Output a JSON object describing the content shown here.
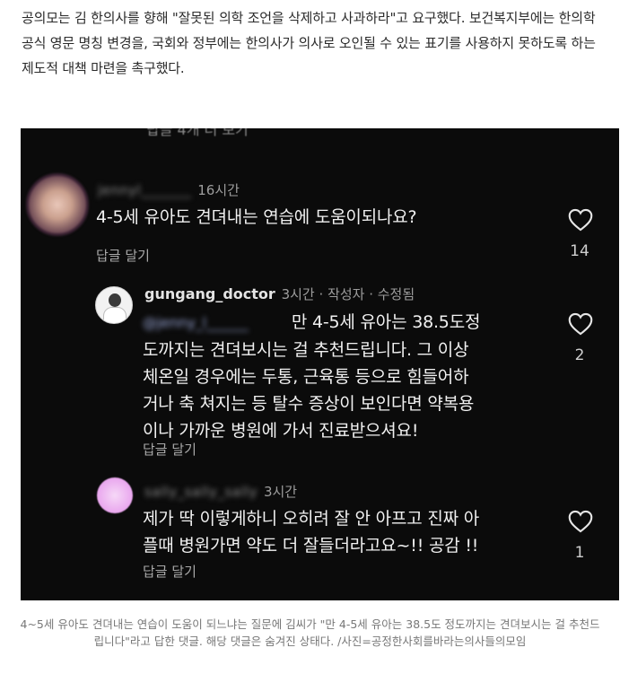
{
  "article": {
    "intro": "공의모는 김 한의사를 향해 \"잘못된 의학 조언을 삭제하고 사과하라\"고 요구했다. 보건복지부에는 한의학 공식 영문 명칭 변경을, 국회와 정부에는 한의사가 의사로 오인될 수 있는 표기를 사용하지 못하도록 하는 제도적 대책 마련을 촉구했다.",
    "caption": "4~5세 유아도 견뎌내는 연습이 도움이 되느냐는 질문에 김씨가 \"만 4-5세 유아는 38.5도 정도까지는 견뎌보시는 걸 추천드립니다\"라고 답한 댓글. 해당 댓글은 숨겨진 상태다. /사진=공정한사회를바라는의사들의모임"
  },
  "screenshot": {
    "cut_text": "답글 4개 더 보기",
    "comments": [
      {
        "username": "jennyl_______",
        "time": "16시간",
        "text": "4-5세 유아도 견뎌내는 연습에 도움이되나요?",
        "reply_label": "답글 달기",
        "likes": "14"
      },
      {
        "username": "gungang_doctor",
        "meta": "3시간 · 작성자 · 수정됨",
        "mention": "@jenny_l______",
        "text_line1": "만 4-5세 유아는 38.5도정",
        "text_line2": "도까지는 견뎌보시는 걸 추천드립니다. 그 이상",
        "text_line3": "체온일 경우에는 두통, 근육통 등으로 힘들어하",
        "text_line4": "거나 축 쳐지는 등 탈수 증상이 보인다면 약복용",
        "text_line5": "이나 가까운 병원에 가서 진료받으셔요!",
        "reply_label": "답글 달기",
        "likes": "2"
      },
      {
        "username": "sally_sally_sally",
        "time": "3시간",
        "text_line1": "제가 딱 이렇게하니 오히려 잘 안 아프고 진짜 아",
        "text_line2": "플때 병원가면 약도 더 잘들더라고요~!! 공감 !!",
        "reply_label": "답글 달기",
        "likes": "1"
      }
    ]
  }
}
